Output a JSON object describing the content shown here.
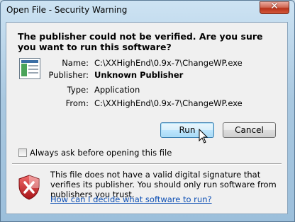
{
  "window": {
    "title": "Open File - Security Warning",
    "close_glyph": "✕"
  },
  "message": {
    "headline": "The publisher could not be verified.  Are you sure you want to run this software?"
  },
  "details": {
    "icon": "application-icon",
    "fields": [
      {
        "label": "Name:",
        "value": "C:\\XXHighEnd\\0.9x-7\\ChangeWP.exe"
      },
      {
        "label": "Publisher:",
        "value": "Unknown Publisher"
      },
      {
        "label": "Type:",
        "value": "Application"
      },
      {
        "label": "From:",
        "value": "C:\\XXHighEnd\\0.9x-7\\ChangeWP.exe"
      }
    ]
  },
  "buttons": {
    "run_label": "Run",
    "cancel_label": "Cancel"
  },
  "checkbox": {
    "label": "Always ask before opening this file",
    "checked": false
  },
  "warning": {
    "icon": "shield-error-icon",
    "text": "This file does not have a valid digital signature that verifies its publisher.  You should only run software from publishers you trust.",
    "link": "How can I decide what software to run?"
  },
  "colors": {
    "title_bar": "#a9c8e0",
    "link": "#0d4fb4",
    "shield_red": "#c8242a",
    "default_button_border": "#3c7fb1"
  }
}
